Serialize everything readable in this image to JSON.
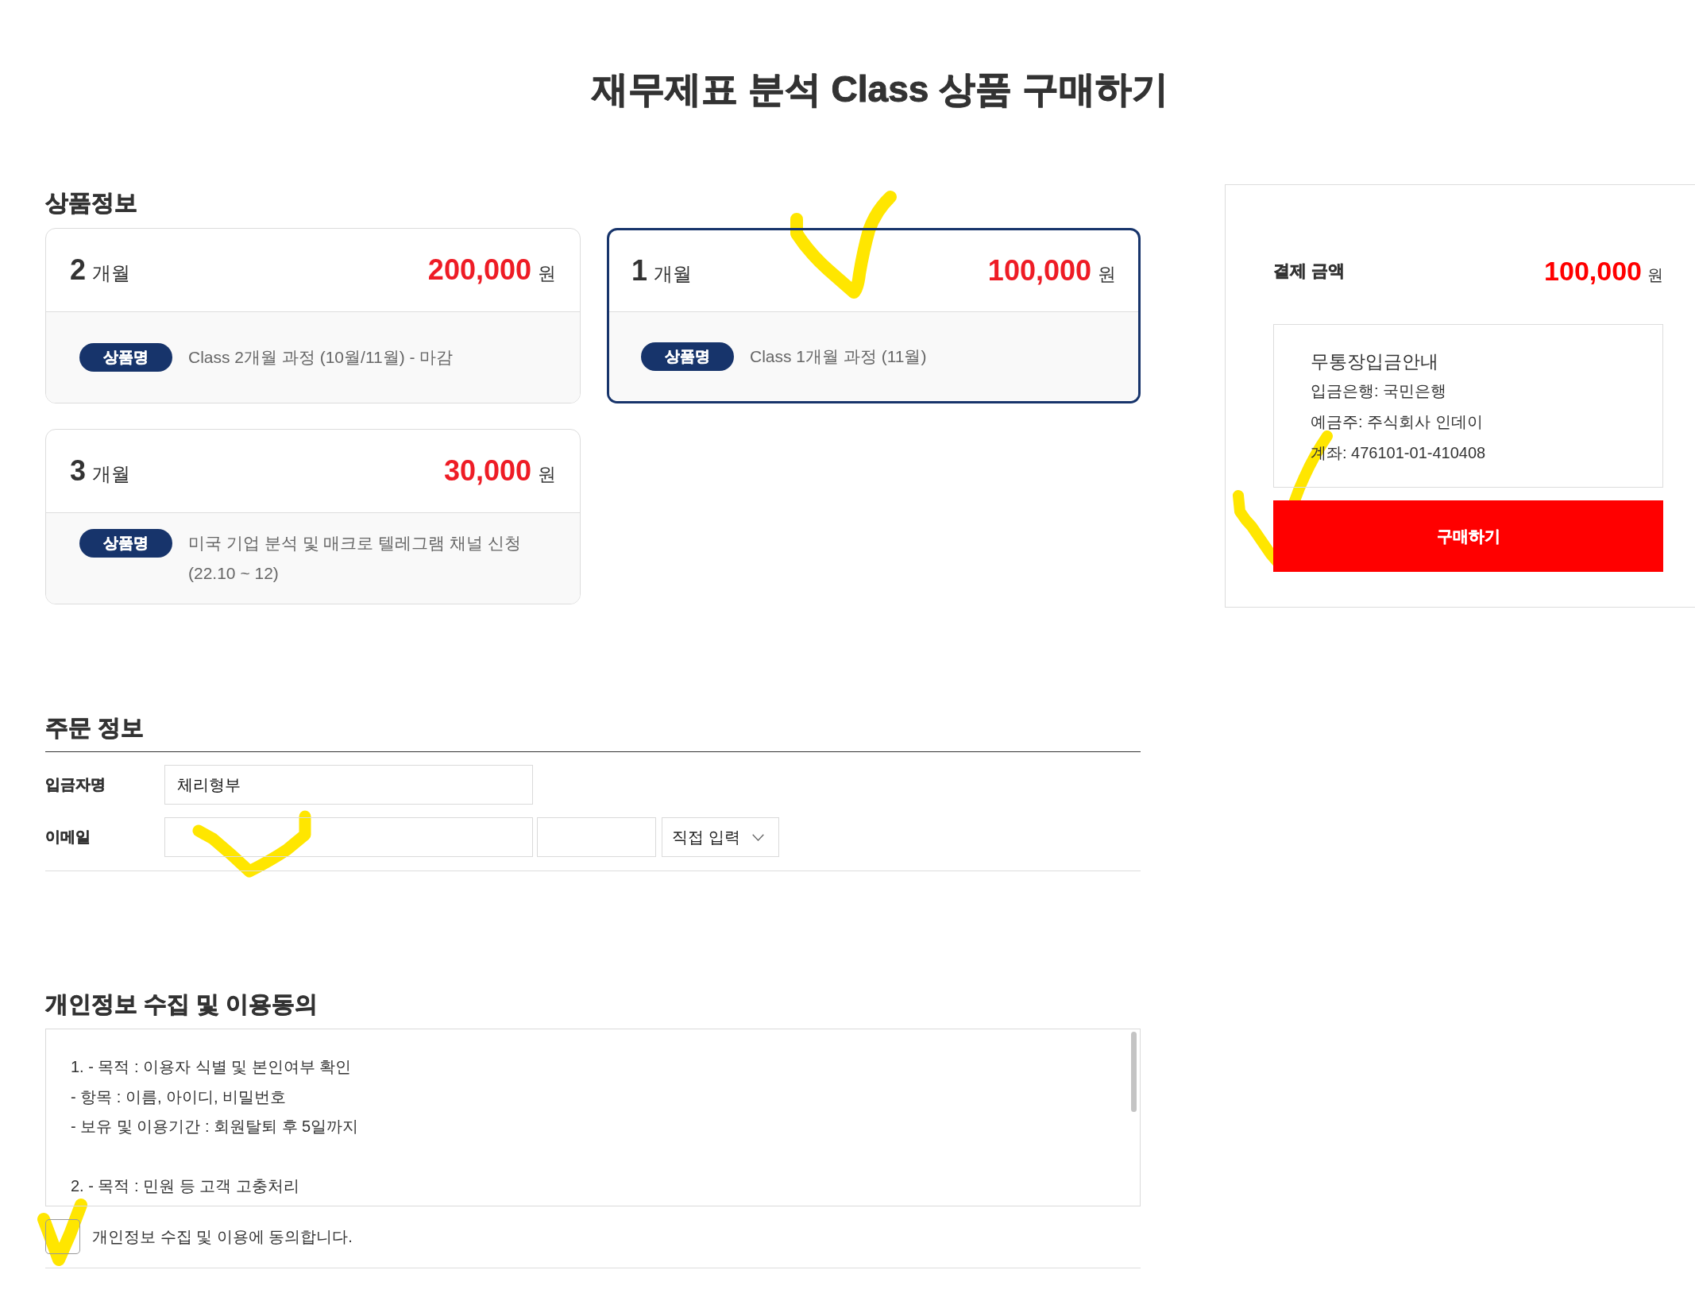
{
  "page_title": "재무제표 분석 Class 상품 구매하기",
  "product_info": {
    "heading": "상품정보",
    "products": [
      {
        "months": "2",
        "months_unit": "개월",
        "price": "200,000",
        "currency": "원",
        "tag": "상품명",
        "name": "Class 2개월 과정 (10월/11월) - 마감",
        "selected": false
      },
      {
        "months": "1",
        "months_unit": "개월",
        "price": "100,000",
        "currency": "원",
        "tag": "상품명",
        "name": "Class 1개월 과정 (11월)",
        "selected": true
      },
      {
        "months": "3",
        "months_unit": "개월",
        "price": "30,000",
        "currency": "원",
        "tag": "상품명",
        "name": "미국 기업 분석 및 매크로 텔레그램 채널 신청 (22.10 ~ 12)",
        "selected": false
      }
    ]
  },
  "payment": {
    "label": "결제 금액",
    "amount": "100,000",
    "currency": "원",
    "bank_transfer": {
      "title": "무통장입금안내",
      "lines": [
        "입금은행: 국민은행",
        "예금주: 주식회사 인데이",
        "계좌: 476101-01-410408"
      ]
    },
    "buy_button": "구매하기"
  },
  "order_info": {
    "heading": "주문 정보",
    "fields": [
      {
        "kind": "text",
        "label": "입금자명",
        "value": "체리형부"
      },
      {
        "kind": "email",
        "label": "이메일",
        "domain_select": "직접 입력"
      }
    ]
  },
  "privacy": {
    "heading": "개인정보 수집 및 이용동의",
    "terms": [
      {
        "lines": [
          "1. - 목적 : 이용자 식별 및 본인여부 확인",
          "- 항목 : 이름, 아이디, 비밀번호",
          "- 보유 및 이용기간 : 회원탈퇴 후 5일까지"
        ]
      },
      {
        "lines": [
          "2. - 목적 : 민원 등 고객 고충처리"
        ]
      }
    ],
    "agree": {
      "label": "개인정보 수집 및 이용에 동의합니다.",
      "checked": false
    }
  }
}
